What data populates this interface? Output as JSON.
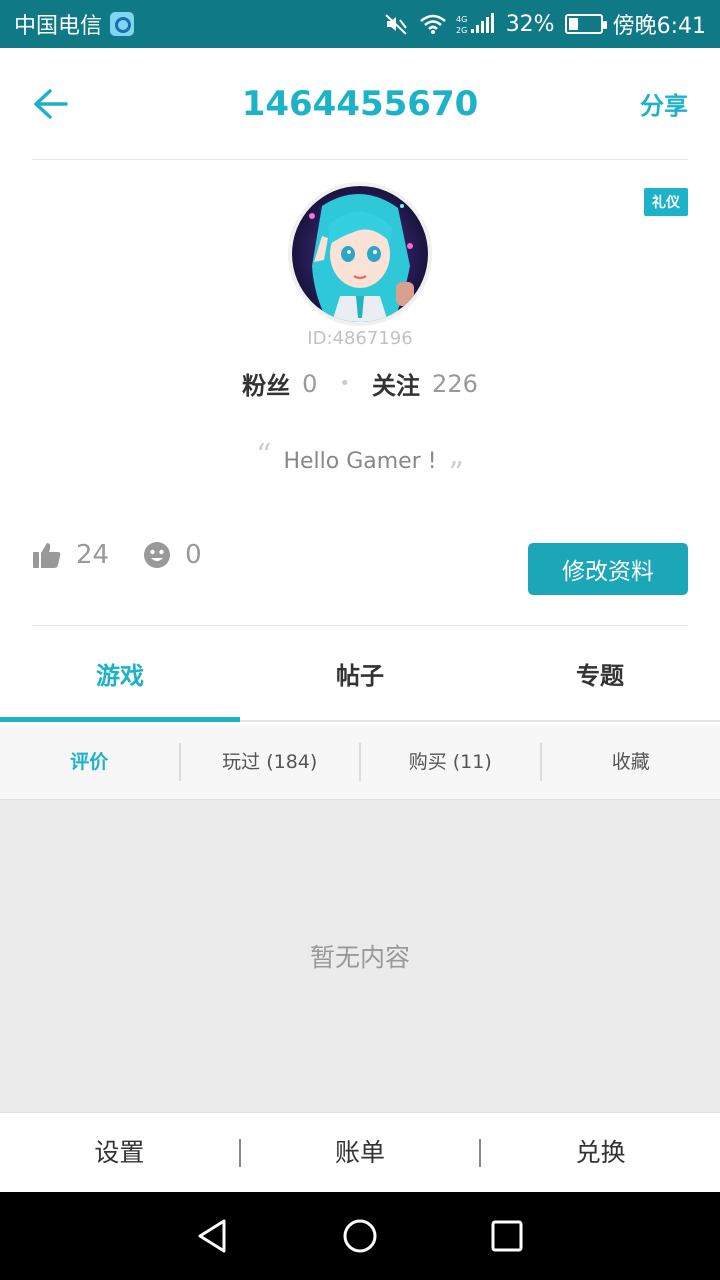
{
  "status_bar": {
    "carrier": "中国电信",
    "battery_percent": "32%",
    "battery_level": 0.32,
    "time": "傍晚6:41",
    "network": "4G 2G"
  },
  "header": {
    "back_icon": "arrow-left-icon",
    "title": "1464455670",
    "share_label": "分享"
  },
  "profile": {
    "badge": "礼仪",
    "user_id": "ID:4867196",
    "fans_label": "粉丝",
    "fans_count": "0",
    "following_label": "关注",
    "following_count": "226",
    "signature": "Hello Gamer !",
    "likes_count": "24",
    "smiles_count": "0",
    "edit_button": "修改资料"
  },
  "tabs": [
    {
      "label": "游戏",
      "active": true
    },
    {
      "label": "帖子",
      "active": false
    },
    {
      "label": "专题",
      "active": false
    }
  ],
  "subtabs": [
    {
      "label": "评价",
      "active": true
    },
    {
      "label": "玩过 (184)",
      "active": false
    },
    {
      "label": "购买 (11)",
      "active": false
    },
    {
      "label": "收藏",
      "active": false
    }
  ],
  "content": {
    "empty_text": "暂无内容"
  },
  "bottom_menu": {
    "settings": "设置",
    "bill": "账单",
    "redeem": "兑换"
  },
  "colors": {
    "accent": "#1cb3c8",
    "status_bar": "#0f7a86",
    "button": "#1ba7b8"
  }
}
